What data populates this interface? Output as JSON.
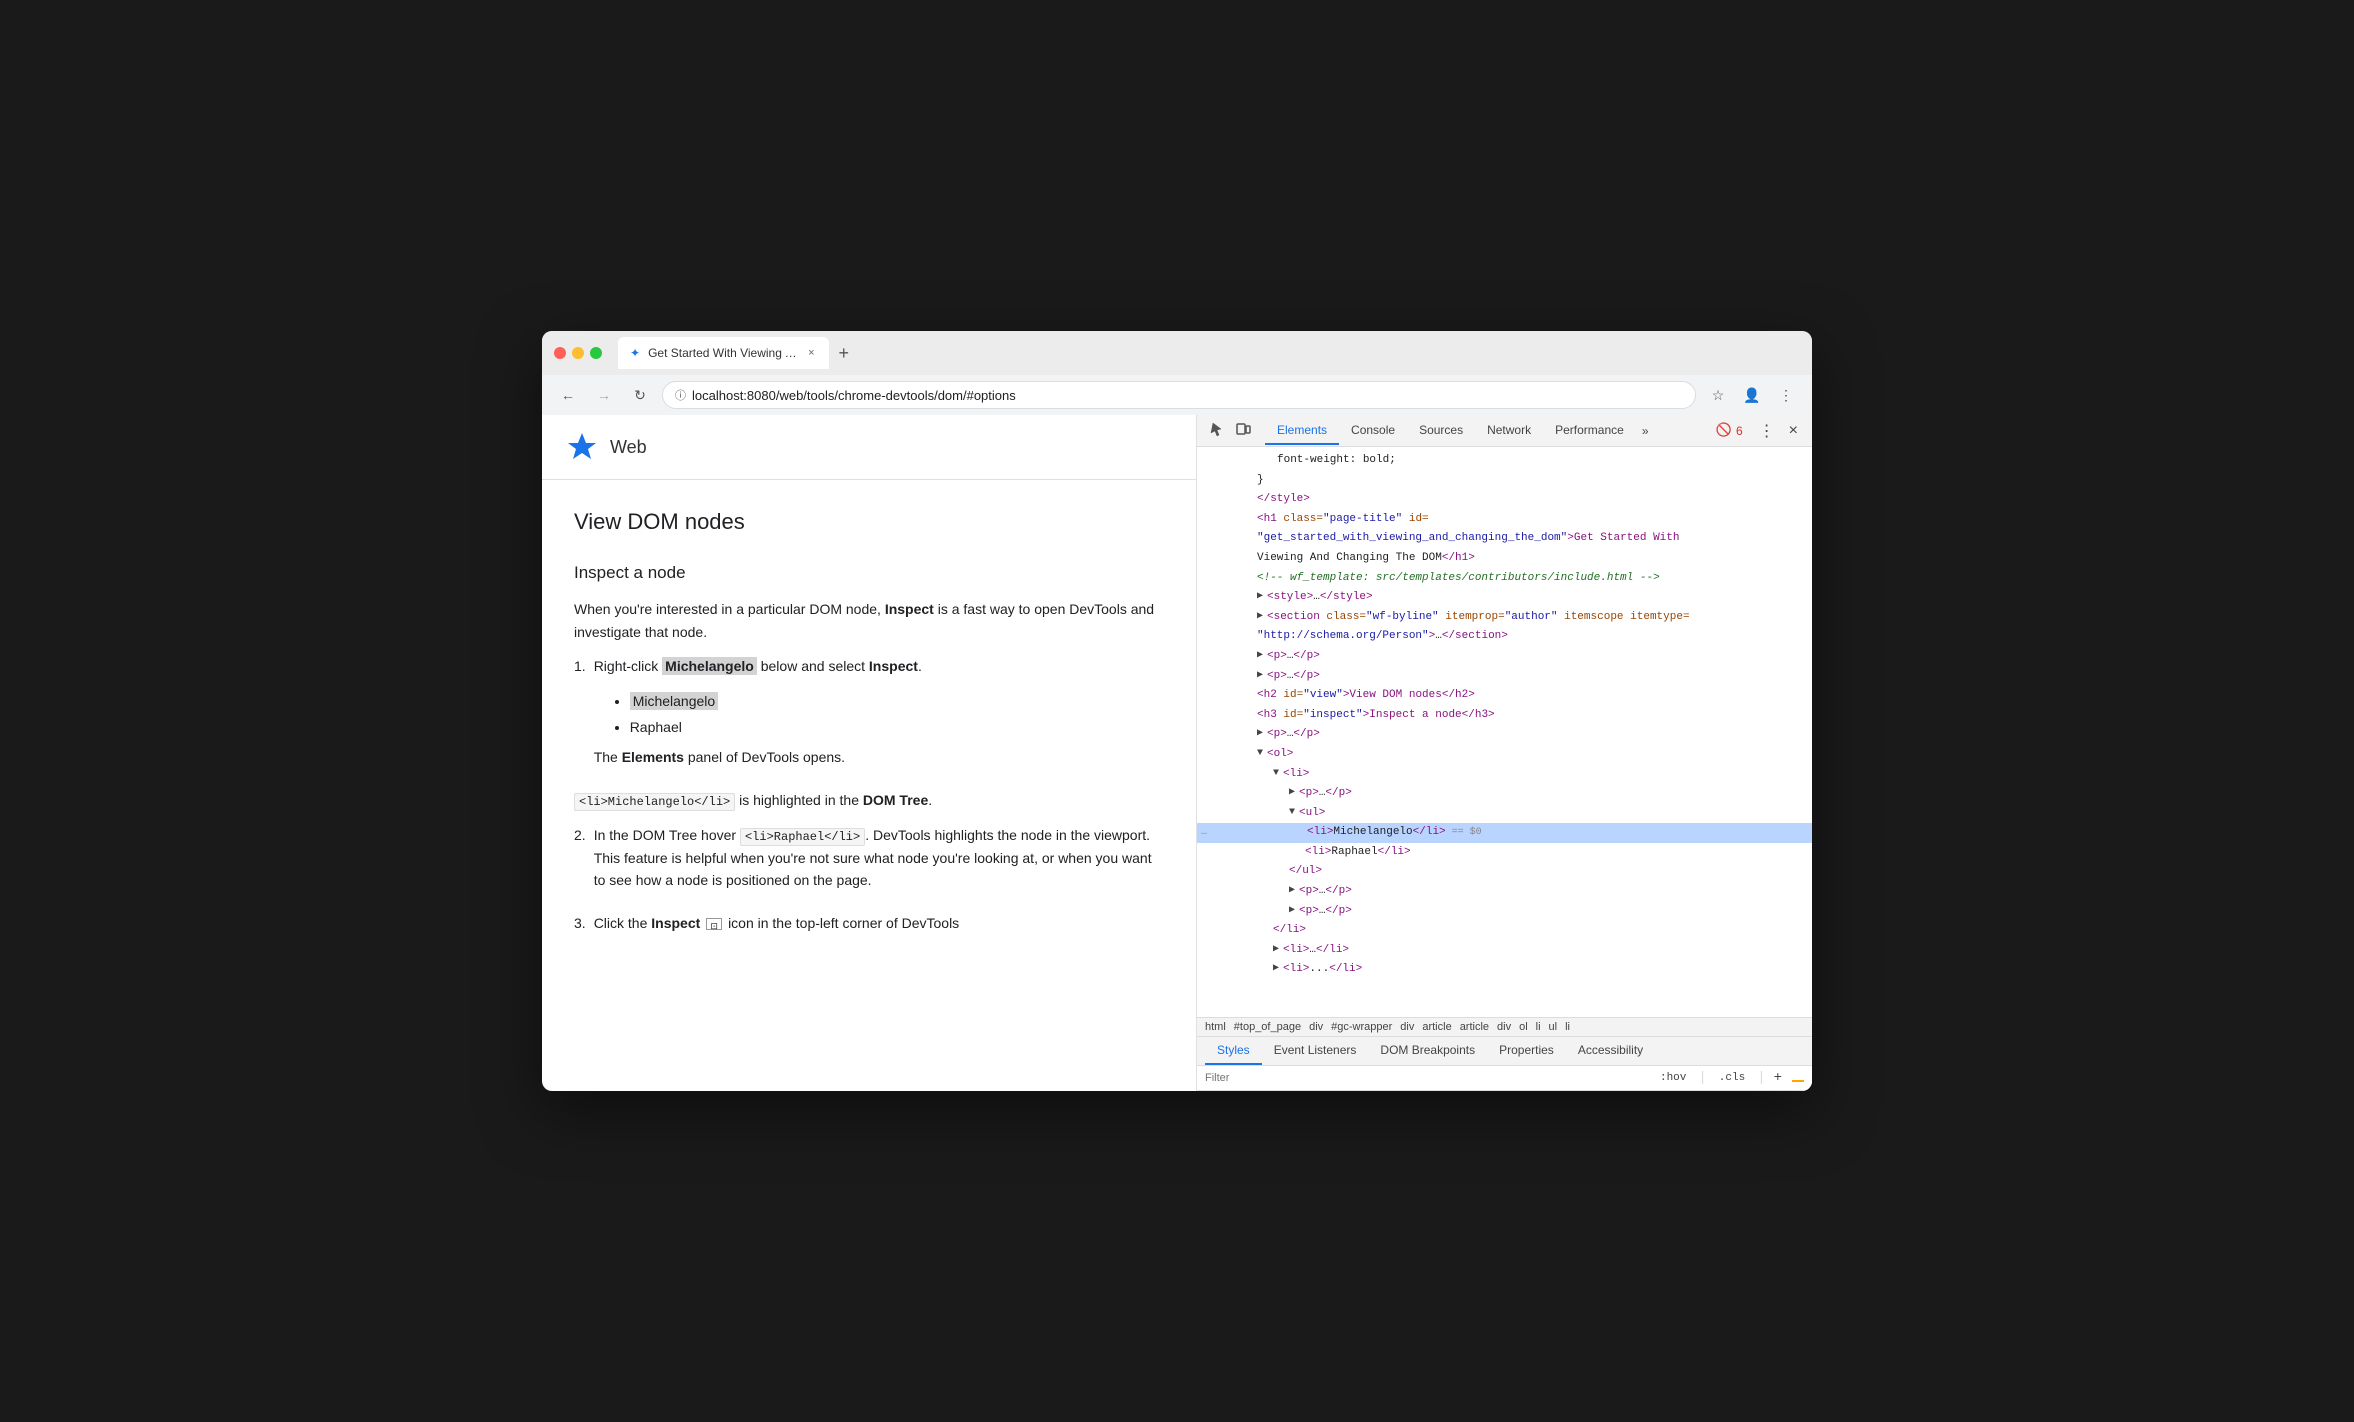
{
  "browser": {
    "traffic_lights": [
      "close",
      "minimize",
      "maximize"
    ],
    "tab": {
      "favicon": "✦",
      "title": "Get Started With Viewing And",
      "close": "×"
    },
    "new_tab": "+",
    "nav": {
      "back": "←",
      "forward": "→",
      "reload": "↻",
      "url": "localhost:8080/web/tools/chrome-devtools/dom/#options",
      "bookmark": "☆",
      "account": "👤",
      "menu": "⋮"
    }
  },
  "page": {
    "logo": "✦",
    "brand": "Web",
    "heading": "View DOM nodes",
    "subheading": "Inspect a node",
    "intro": "When you're interested in a particular DOM node,",
    "intro_bold": "Inspect",
    "intro_rest": "is a fast way to open DevTools and investigate that node.",
    "steps": [
      {
        "num": "1.",
        "text_pre": "Right-click",
        "text_bold": "Michelangelo",
        "text_mid": "below and select",
        "text_bold2": "Inspect",
        "text_end": ".",
        "list_items": [
          "Michelangelo",
          "Raphael"
        ],
        "note": "The",
        "note_bold": "Elements",
        "note_rest": "panel of DevTools opens."
      },
      {
        "num": "2.",
        "text_pre_code": "<li>Michelangelo</li>",
        "text_mid": "is highlighted in the",
        "text_bold": "DOM Tree",
        "text_end": "."
      }
    ],
    "step2_text_pre": "In the DOM Tree hover",
    "step2_code": "<li>Raphael</li>",
    "step2_rest": ". DevTools highlights the node in the viewport. This feature is helpful when you're not sure what node you're looking at, or when you want to see how a node is positioned on the page.",
    "step3_num": "3.",
    "step3_text_pre": "Click the",
    "step3_bold": "Inspect",
    "step3_rest": "icon in the top-left corner of DevTools"
  },
  "devtools": {
    "toolbar_icons": [
      "cursor-inspect-icon",
      "device-toolbar-icon"
    ],
    "tabs": [
      {
        "label": "Elements",
        "active": true
      },
      {
        "label": "Console",
        "active": false
      },
      {
        "label": "Sources",
        "active": false
      },
      {
        "label": "Network",
        "active": false
      },
      {
        "label": "Performance",
        "active": false
      }
    ],
    "more": "»",
    "error_count": "6",
    "dom_lines": [
      {
        "indent": 12,
        "content": "font-weight: bold;",
        "type": "text"
      },
      {
        "indent": 8,
        "content": "}",
        "type": "text"
      },
      {
        "indent": 8,
        "content": "</style>",
        "type": "tag",
        "toggle": ""
      },
      {
        "indent": 8,
        "content": "<h1 class=\"page-title\" id=",
        "type": "tag-attr"
      },
      {
        "indent": 8,
        "content": "\"get_started_with_viewing_and_changing_the_dom\">Get Started With",
        "type": "attr-value-text"
      },
      {
        "indent": 8,
        "content": "Viewing And Changing The DOM</h1>",
        "type": "text"
      },
      {
        "indent": 8,
        "content": "<!-- wf_template: src/templates/contributors/include.html -->",
        "type": "comment"
      },
      {
        "indent": 8,
        "content": "<style>…</style>",
        "type": "tag",
        "toggle": "▶"
      },
      {
        "indent": 8,
        "content": "<section class=\"wf-byline\" itemprop=\"author\" itemscope itemtype=",
        "type": "tag-attr"
      },
      {
        "indent": 8,
        "content": "\"http://schema.org/Person\">…</section>",
        "type": "text"
      },
      {
        "indent": 8,
        "content": "<p>…</p>",
        "type": "tag",
        "toggle": "▶"
      },
      {
        "indent": 8,
        "content": "<p>…</p>",
        "type": "tag",
        "toggle": "▶"
      },
      {
        "indent": 8,
        "content": "<h2 id=\"view\">View DOM nodes</h2>",
        "type": "tag"
      },
      {
        "indent": 8,
        "content": "<h3 id=\"inspect\">Inspect a node</h3>",
        "type": "tag"
      },
      {
        "indent": 8,
        "content": "<p>…</p>",
        "type": "tag",
        "toggle": "▶"
      },
      {
        "indent": 8,
        "content": "<ol>",
        "type": "tag",
        "toggle": "▼"
      },
      {
        "indent": 12,
        "content": "<li>",
        "type": "tag",
        "toggle": "▼"
      },
      {
        "indent": 16,
        "content": "<p>…</p>",
        "type": "tag",
        "toggle": "▶"
      },
      {
        "indent": 16,
        "content": "<ul>",
        "type": "tag",
        "toggle": "▼"
      },
      {
        "indent": 20,
        "content": "<li>Michelangelo</li> == $0",
        "type": "selected"
      },
      {
        "indent": 20,
        "content": "<li>Raphael</li>",
        "type": "tag"
      },
      {
        "indent": 16,
        "content": "</ul>",
        "type": "tag"
      },
      {
        "indent": 16,
        "content": "<p>…</p>",
        "type": "tag",
        "toggle": "▶"
      },
      {
        "indent": 16,
        "content": "<p>…</p>",
        "type": "tag",
        "toggle": "▶"
      },
      {
        "indent": 12,
        "content": "</li>",
        "type": "tag"
      },
      {
        "indent": 12,
        "content": "<li>…</li>",
        "type": "tag",
        "toggle": "▶"
      },
      {
        "indent": 12,
        "content": "<li>...</li>",
        "type": "tag",
        "toggle": "▶"
      }
    ],
    "breadcrumb": [
      "html",
      "#top_of_page",
      "div",
      "#gc-wrapper",
      "div",
      "article",
      "article",
      "div",
      "ol",
      "li",
      "ul",
      "li"
    ],
    "bottom_tabs": [
      "Styles",
      "Event Listeners",
      "DOM Breakpoints",
      "Properties",
      "Accessibility"
    ],
    "filter_placeholder": "Filter",
    "filter_pseudo": ":hov",
    "filter_cls": ".cls",
    "filter_plus": "+"
  }
}
